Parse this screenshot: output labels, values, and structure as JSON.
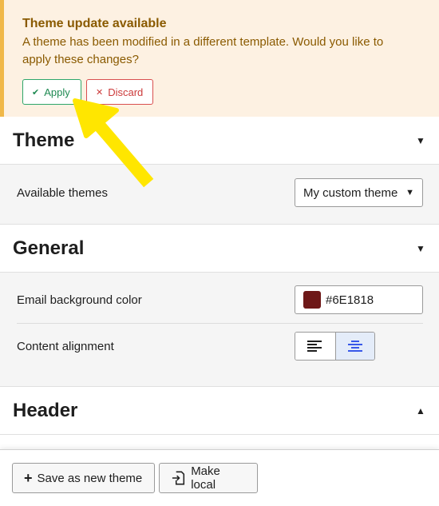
{
  "notice": {
    "title": "Theme update available",
    "message": "A theme has been modified in a different template. Would you like to apply these changes?",
    "apply_label": "Apply",
    "discard_label": "Discard",
    "apply_icon": "check-icon",
    "discard_icon": "x-icon"
  },
  "panels": {
    "theme": {
      "title": "Theme",
      "expanded": true,
      "available_themes_label": "Available themes",
      "selected_theme": "My custom theme"
    },
    "general": {
      "title": "General",
      "expanded": true,
      "bg_color_label": "Email background color",
      "bg_color_value": "#6E1818",
      "content_alignment_label": "Content alignment",
      "alignment_options": [
        "left",
        "center"
      ],
      "alignment_selected": "center"
    },
    "header": {
      "title": "Header",
      "expanded": false
    }
  },
  "footer": {
    "save_new_theme_label": "Save as new theme",
    "make_local_label": "Make local"
  },
  "colors": {
    "notice_bg": "#fdf1e2",
    "notice_accent": "#f0b849",
    "apply_green": "#2ea66a",
    "discard_red": "#d94f4f",
    "swatch": "#6E1818",
    "arrow_yellow": "#ffe600"
  }
}
